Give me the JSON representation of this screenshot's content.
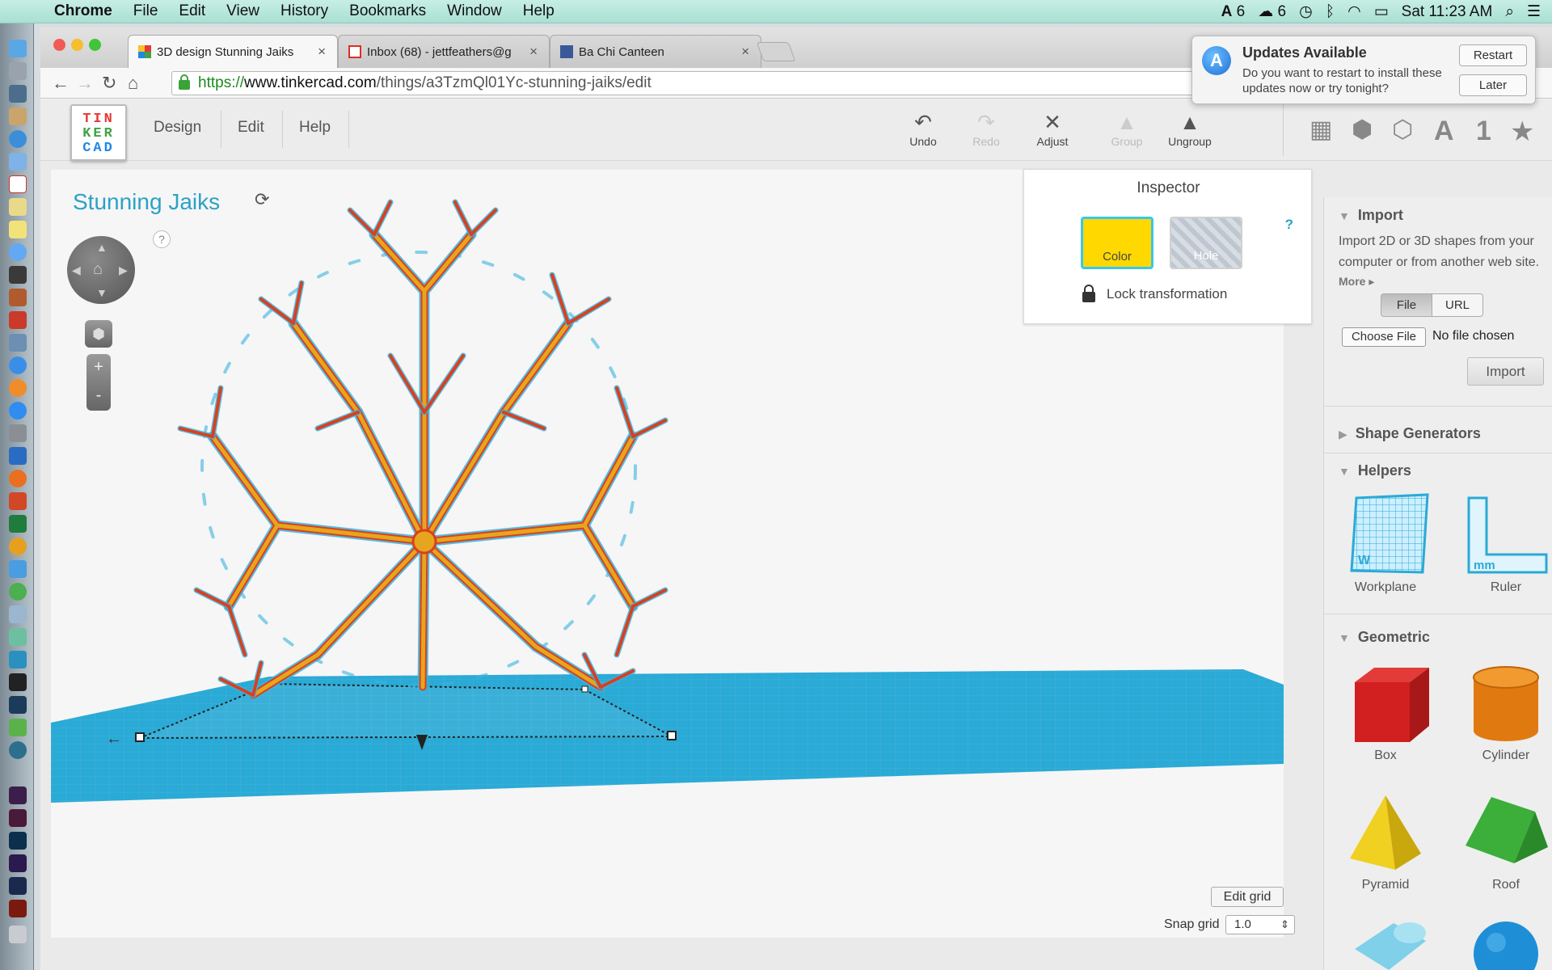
{
  "menubar": {
    "app": "Chrome",
    "items": [
      "File",
      "Edit",
      "View",
      "History",
      "Bookmarks",
      "Window",
      "Help"
    ],
    "status": {
      "adobe_count": "6",
      "cloud_count": "6",
      "clock": "Sat 11:23 AM"
    }
  },
  "browser": {
    "tabs": [
      {
        "title": "3D design Stunning Jaiks",
        "favicon": "tinkercad-grid-icon"
      },
      {
        "title": "Inbox (68) - jettfeathers@g",
        "favicon": "gmail-icon"
      },
      {
        "title": "Ba Chi Canteen",
        "favicon": "facebook-icon"
      }
    ],
    "url": {
      "scheme": "https://",
      "host": "www.tinkercad.com",
      "path": "/things/a3TzmQl01Yc-stunning-jaiks/edit"
    }
  },
  "notification": {
    "title": "Updates Available",
    "body": "Do you want to restart to install these updates now or try tonight?",
    "restart_label": "Restart",
    "later_label": "Later"
  },
  "app": {
    "menu": {
      "design": "Design",
      "edit": "Edit",
      "help": "Help"
    },
    "toolbar": {
      "undo": "Undo",
      "redo": "Redo",
      "adjust": "Adjust",
      "group": "Group",
      "ungroup": "Ungroup"
    },
    "right_toolbar": {
      "text_label": "A",
      "number_label": "1"
    }
  },
  "logo": {
    "line1": "TIN",
    "line2": "KER",
    "line3": "CAD"
  },
  "viewport": {
    "title": "Stunning Jaiks",
    "help": "?",
    "zoom_in": "+",
    "zoom_out": "-",
    "edit_grid": "Edit grid",
    "snap_label": "Snap grid",
    "snap_value": "1.0"
  },
  "inspector": {
    "title": "Inspector",
    "color_label": "Color",
    "hole_label": "Hole",
    "help": "?",
    "lock_label": "Lock transformation",
    "color_value": "#ffd800"
  },
  "sidebar": {
    "import": {
      "heading": "Import",
      "description": "Import 2D or 3D shapes from your computer or from another web site.",
      "more": "More",
      "file_tab": "File",
      "url_tab": "URL",
      "choose_file": "Choose File",
      "no_file": "No file chosen",
      "import_button": "Import"
    },
    "shape_generators": "Shape Generators",
    "helpers": {
      "heading": "Helpers",
      "items": [
        "Workplane",
        "Ruler"
      ]
    },
    "geometric": {
      "heading": "Geometric",
      "items": [
        "Box",
        "Cylinder",
        "Pyramid",
        "Roof"
      ]
    }
  }
}
